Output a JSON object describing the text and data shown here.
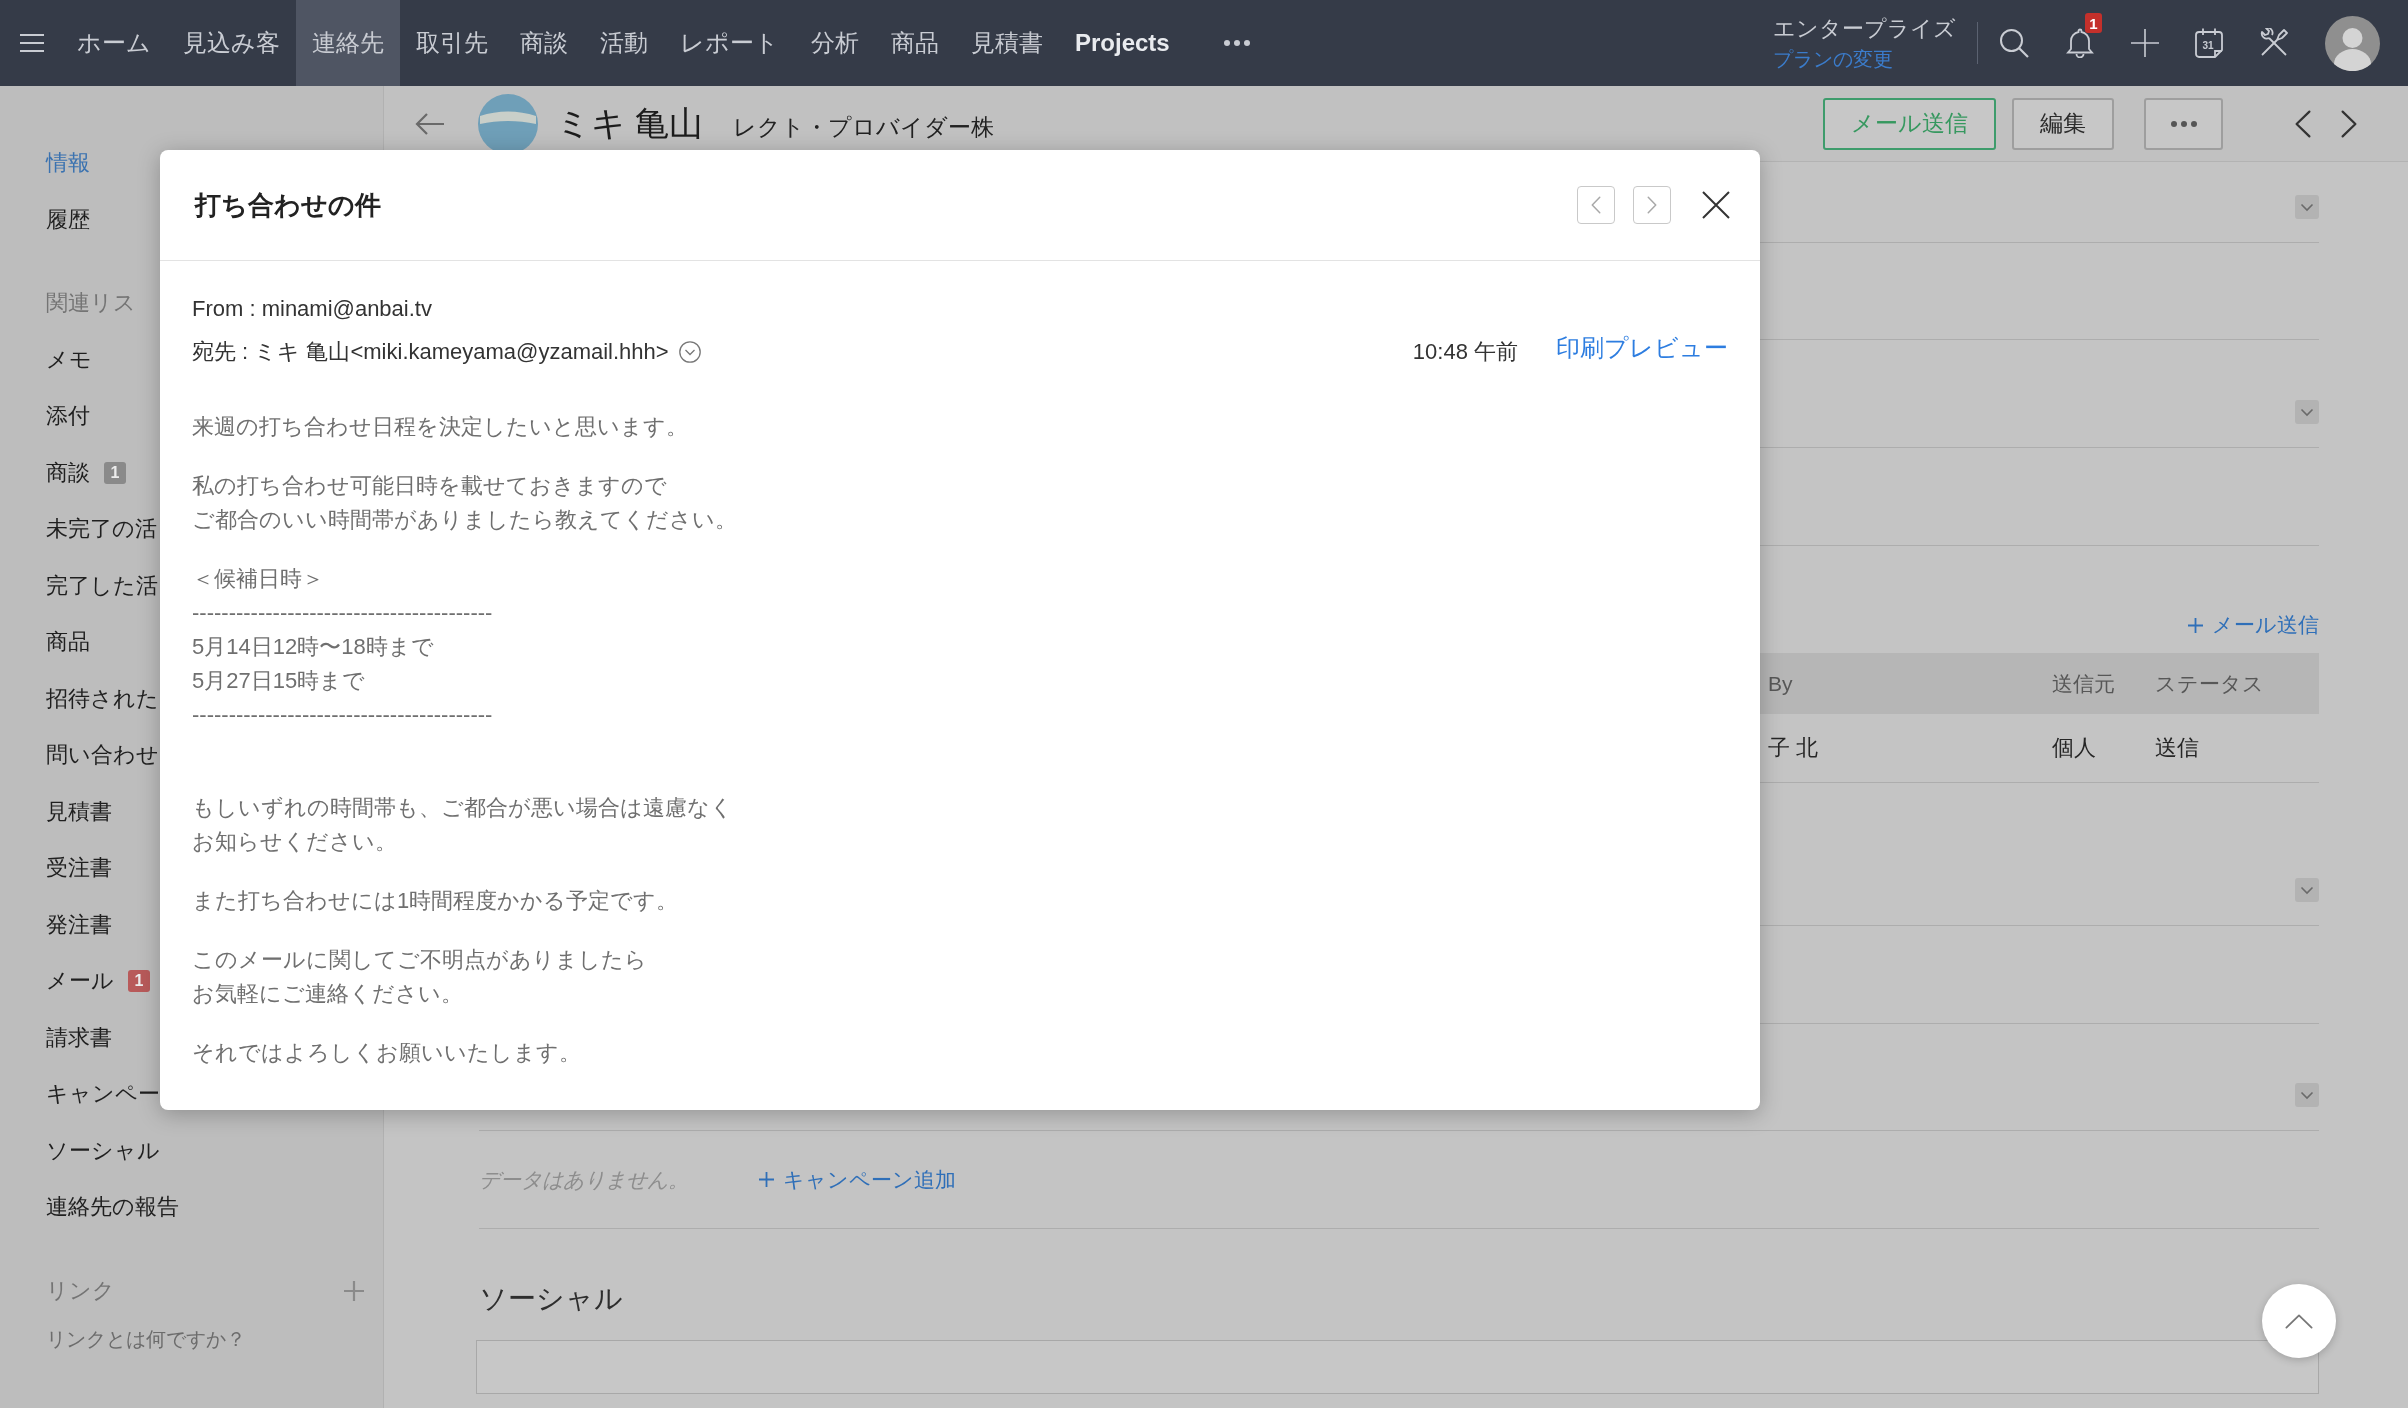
{
  "top_bar": {
    "nav": [
      {
        "label": "ホーム",
        "kind": "standard",
        "selected": false
      },
      {
        "label": "見込み客",
        "kind": "standard",
        "selected": false
      },
      {
        "label": "連絡先",
        "kind": "standard",
        "selected": true
      },
      {
        "label": "取引先",
        "kind": "standard",
        "selected": false
      },
      {
        "label": "商談",
        "kind": "standard",
        "selected": false
      },
      {
        "label": "活動",
        "kind": "standard",
        "selected": false
      },
      {
        "label": "レポート",
        "kind": "standard",
        "selected": false
      },
      {
        "label": "分析",
        "kind": "standard",
        "selected": false
      },
      {
        "label": "商品",
        "kind": "standard",
        "selected": false
      },
      {
        "label": "見積書",
        "kind": "standard",
        "selected": false
      },
      {
        "label": "Projects",
        "kind": "custom",
        "selected": false
      }
    ],
    "edition": "エンタープライズ",
    "upgrade_link": "プランの変更",
    "notification_count": "1",
    "calendar_day": "31"
  },
  "sidebar": {
    "tabs": [
      {
        "label": "情報",
        "selected": true
      },
      {
        "label": "履歴",
        "selected": false
      }
    ],
    "related_heading": "関連リス",
    "related_items": [
      {
        "label": "メモ"
      },
      {
        "label": "添付"
      },
      {
        "label": "商談",
        "badge": {
          "text": "1",
          "color": "#8a8a8a"
        }
      },
      {
        "label": "未完了の活"
      },
      {
        "label": "完了した活"
      },
      {
        "label": "商品"
      },
      {
        "label": "招待された"
      },
      {
        "label": "問い合わせ"
      },
      {
        "label": "見積書"
      },
      {
        "label": "受注書"
      },
      {
        "label": "発注書"
      },
      {
        "label": "メール",
        "badge": {
          "text": "1",
          "color": "#b85a5a"
        }
      },
      {
        "label": "請求書"
      },
      {
        "label": "キャンペー"
      },
      {
        "label": "ソーシャル"
      },
      {
        "label": "連絡先の報告"
      }
    ],
    "links_heading": "リンク",
    "links_help": "リンクとは何ですか？"
  },
  "record_header": {
    "name": "ミキ 亀山",
    "account": "レクト・プロバイダー株",
    "buttons": [
      {
        "label": "メール送信",
        "kind": "primary"
      },
      {
        "label": "編集",
        "kind": "secondary"
      }
    ]
  },
  "content": {
    "emails": {
      "send_link": "メール送信",
      "columns": [
        "By",
        "送信元",
        "ステータス"
      ],
      "rows": [
        [
          "子 北",
          "個人",
          "送信"
        ]
      ]
    },
    "campaigns": {
      "empty_text": "データはありません。",
      "add_link": "キャンペーン追加"
    },
    "social": {
      "title": "ソーシャル"
    }
  },
  "email_dialog": {
    "title": "打ち合わせの件",
    "from": "From : minami@anbai.tv",
    "to": "宛先 : ミキ 亀山<miki.kameyama@yzamail.hhh>",
    "time": "10:48 午前",
    "print_preview": "印刷プレビュー",
    "body": [
      {
        "kind": "paragraph",
        "lines": [
          "来週の打ち合わせ日程を決定したいと思います。"
        ]
      },
      {
        "kind": "paragraph",
        "lines": [
          "私の打ち合わせ可能日時を載せておきますので",
          "ご都合のいい時間帯がありましたら教えてください。"
        ]
      },
      {
        "kind": "schedule",
        "lines": [
          "＜候補日時＞",
          "-----------------------------------------",
          "5月14日12時〜18時まで",
          "5月27日15時まで",
          "-----------------------------------------"
        ]
      },
      {
        "kind": "paragraph",
        "lines": [
          "もしいずれの時間帯も、ご都合が悪い場合は遠慮なく",
          "お知らせください。"
        ]
      },
      {
        "kind": "paragraph",
        "lines": [
          "また打ち合わせには1時間程度かかる予定です。"
        ]
      },
      {
        "kind": "paragraph",
        "lines": [
          "このメールに関してご不明点がありましたら",
          "お気軽にご連絡ください。"
        ]
      },
      {
        "kind": "paragraph",
        "lines": [
          "それではよろしくお願いいたします。"
        ]
      }
    ]
  }
}
